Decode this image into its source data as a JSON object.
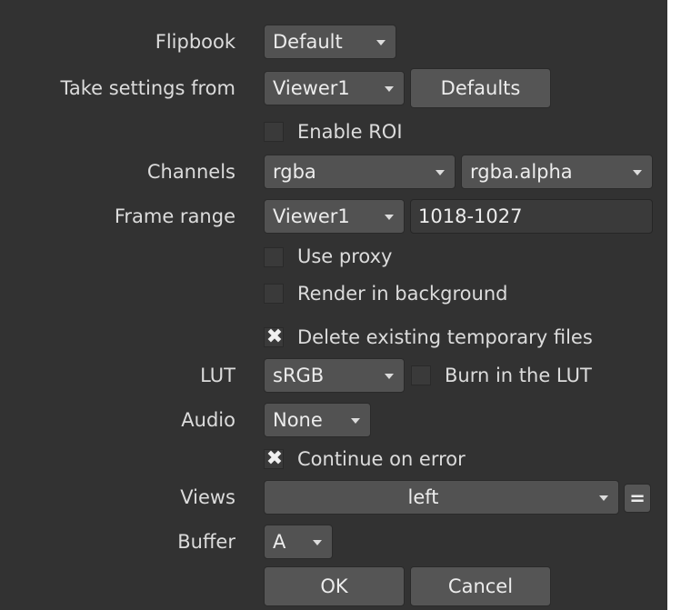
{
  "flipbook": {
    "label": "Flipbook",
    "value": "Default"
  },
  "take_settings": {
    "label": "Take settings from",
    "value": "Viewer1",
    "defaults_label": "Defaults"
  },
  "enable_roi": {
    "label": "Enable ROI",
    "checked": false
  },
  "channels": {
    "label": "Channels",
    "value": "rgba",
    "value2": "rgba.alpha"
  },
  "frame_range": {
    "label": "Frame range",
    "mode": "Viewer1",
    "range": "1018-1027"
  },
  "use_proxy": {
    "label": "Use proxy",
    "checked": false
  },
  "render_background": {
    "label": "Render in background",
    "checked": false
  },
  "delete_temp": {
    "label": "Delete existing temporary files",
    "checked": true
  },
  "lut": {
    "label": "LUT",
    "value": "sRGB",
    "burn_label": "Burn in the LUT",
    "burn_checked": false
  },
  "audio": {
    "label": "Audio",
    "value": "None"
  },
  "continue_error": {
    "label": "Continue on error",
    "checked": true
  },
  "views": {
    "label": "Views",
    "value": "left",
    "eq_label": "="
  },
  "buffer": {
    "label": "Buffer",
    "value": "A"
  },
  "buttons": {
    "ok": "OK",
    "cancel": "Cancel"
  },
  "icons": {
    "dropdown": "chevron-down-icon",
    "check": "check-x-icon"
  },
  "colors": {
    "panel_bg": "#323232",
    "control_bg": "#525252",
    "text": "#e6e6e6"
  }
}
